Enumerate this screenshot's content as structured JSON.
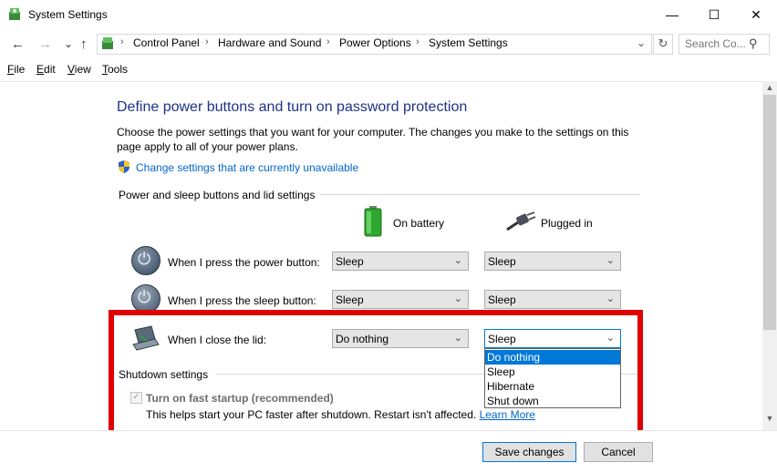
{
  "window": {
    "title": "System Settings",
    "minimize_glyph": "—",
    "maximize_glyph": "☐",
    "close_glyph": "✕"
  },
  "address_bar": {
    "back_glyph": "←",
    "forward_glyph": "→",
    "recent_glyph": "⌄",
    "up_glyph": "↑",
    "breadcrumbs": [
      "Control Panel",
      "Hardware and Sound",
      "Power Options",
      "System Settings"
    ],
    "separator": "›",
    "dropdown_glyph": "⌄",
    "refresh_glyph": "↻",
    "search_placeholder": "Search Co...",
    "search_glyph": "⚲"
  },
  "menu": {
    "items": [
      {
        "label": "File",
        "access": "F",
        "rest": "ile"
      },
      {
        "label": "Edit",
        "access": "E",
        "rest": "dit"
      },
      {
        "label": "View",
        "access": "V",
        "rest": "iew"
      },
      {
        "label": "Tools",
        "access": "T",
        "rest": "ools"
      }
    ]
  },
  "content": {
    "heading": "Define power buttons and turn on password protection",
    "description": "Choose the power settings that you want for your computer. The changes you make to the settings on this page apply to all of your power plans.",
    "change_link": "Change settings that are currently unavailable",
    "group_power": "Power and sleep buttons and lid settings",
    "col_battery": "On battery",
    "col_plugged": "Plugged in",
    "rows": [
      {
        "label": "When I press the power button:",
        "battery": "Sleep",
        "plugged": "Sleep"
      },
      {
        "label": "When I press the sleep button:",
        "battery": "Sleep",
        "plugged": "Sleep"
      },
      {
        "label": "When I close the lid:",
        "battery": "Do nothing",
        "plugged": "Sleep"
      }
    ],
    "combo_glyph": "⌄",
    "dropdown_options": [
      "Do nothing",
      "Sleep",
      "Hibernate",
      "Shut down"
    ],
    "dropdown_selected": "Do nothing",
    "group_shutdown": "Shutdown settings",
    "fast_startup_label": "Turn on fast startup (recommended)",
    "fast_startup_checked": true,
    "fast_startup_check_glyph": "✓",
    "fast_startup_desc": "This helps start your PC faster after shutdown. Restart isn't affected.",
    "learn_more": "Learn More"
  },
  "scrollbar": {
    "up_glyph": "▲",
    "down_glyph": "▼"
  },
  "buttons": {
    "save": "Save changes",
    "cancel": "Cancel"
  },
  "colors": {
    "heading": "#1e3287",
    "link": "#0066cc",
    "highlight": "#e00000",
    "dropdown_selection": "#0078d7"
  },
  "icons": {
    "app": "control-panel-icon",
    "shield": "uac-shield-icon",
    "battery": "battery-icon",
    "plug": "power-plug-icon",
    "power_button": "power-button-icon",
    "sleep_button": "sleep-button-icon",
    "lid": "laptop-lid-icon"
  }
}
